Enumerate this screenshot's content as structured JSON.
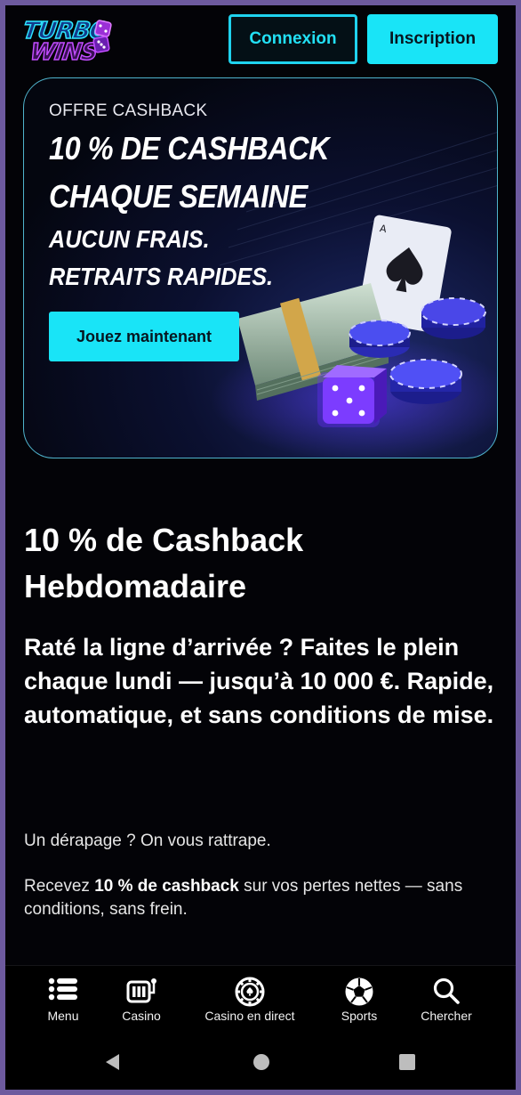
{
  "header": {
    "logo_line1": "TURBO",
    "logo_line2": "WINS",
    "login_label": "Connexion",
    "signup_label": "Inscription"
  },
  "banner": {
    "label": "OFFRE CASHBACK",
    "title": "10 % DE CASHBACK CHAQUE SEMAINE",
    "subtitle_line1": "AUCUN FRAIS.",
    "subtitle_line2": "RETRAITS RAPIDES.",
    "cta_label": "Jouez maintenant"
  },
  "content": {
    "title": "10 % de Cashback Hebdomadaire",
    "lead": "Raté la ligne d’arrivée ? Faites le plein chaque lundi — jusqu’à 10 000 €. Rapide, automatique, et sans conditions de mise.",
    "paragraph1": "Un dérapage ? On vous rattrape.",
    "paragraph2_prefix": "Recevez ",
    "paragraph2_bold": "10 % de cashback",
    "paragraph2_suffix": " sur vos pertes nettes — sans conditions, sans frein."
  },
  "bottom_nav": {
    "items": [
      {
        "label": "Menu",
        "icon": "menu-icon"
      },
      {
        "label": "Casino",
        "icon": "slot-machine-icon"
      },
      {
        "label": "Casino en direct",
        "icon": "casino-chip-icon"
      },
      {
        "label": "Sports",
        "icon": "soccer-ball-icon"
      },
      {
        "label": "Chercher",
        "icon": "search-icon"
      }
    ]
  },
  "colors": {
    "accent": "#19e4f7",
    "background": "#030307",
    "frame": "#6d5a9e"
  }
}
